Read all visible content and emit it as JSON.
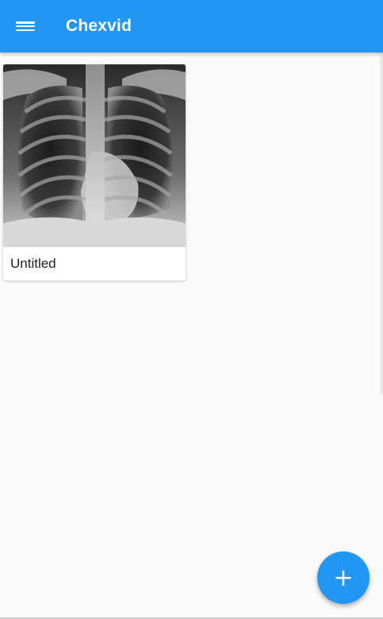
{
  "app_bar": {
    "title": "Chexvid",
    "menu_icon": "hamburger-menu-icon",
    "color": "#2196f3"
  },
  "gallery": {
    "items": [
      {
        "title": "Untitled",
        "thumbnail": "chest-xray-image"
      }
    ]
  },
  "fab": {
    "icon": "plus-icon",
    "glyph": "+",
    "color": "#2196f3"
  }
}
